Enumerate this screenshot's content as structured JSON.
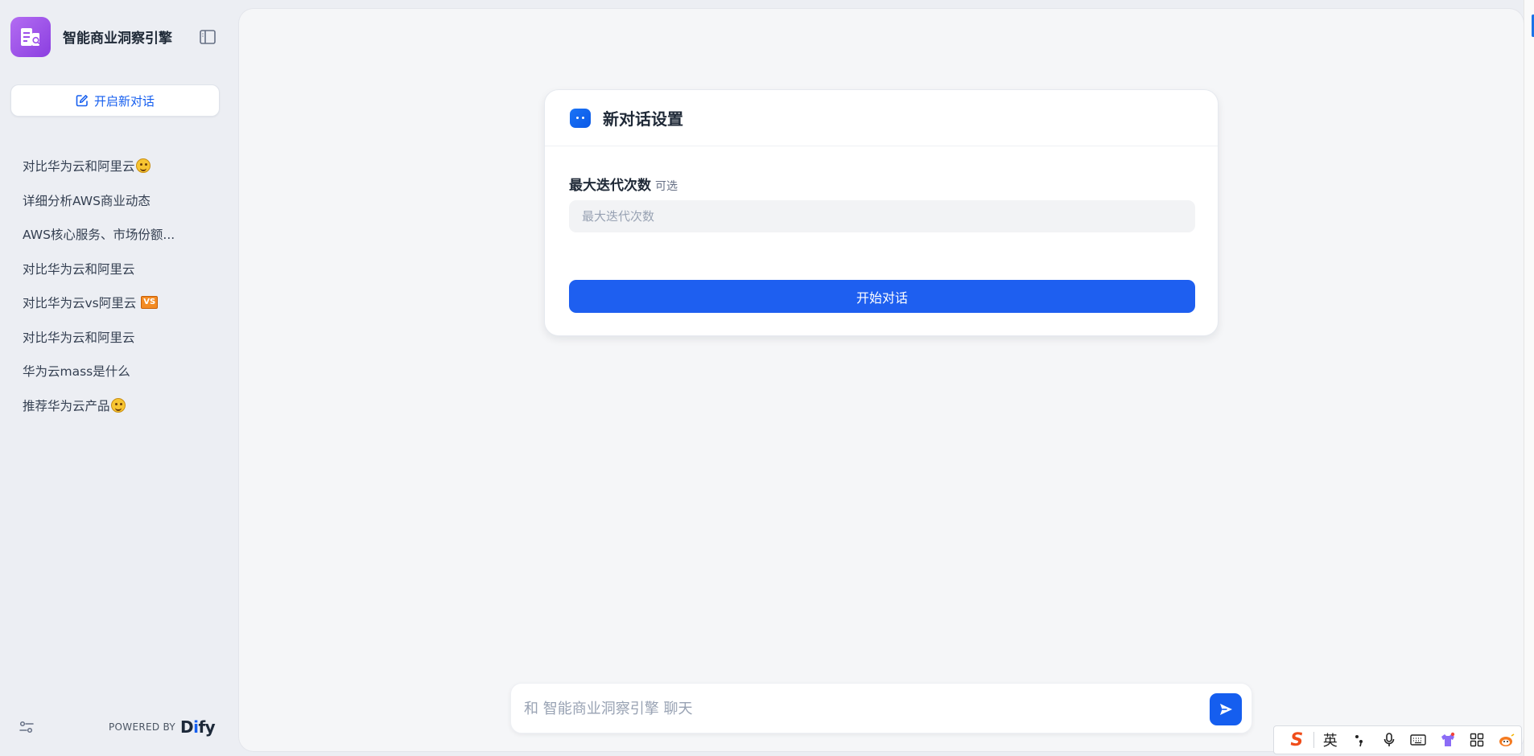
{
  "app": {
    "title": "智能商业洞察引擎",
    "brand_color": "#8b3fe0",
    "accent": "#155eef"
  },
  "sidebar": {
    "new_chat_label": "开启新对话",
    "conversations": [
      {
        "label": "对比华为云和阿里云",
        "emoji": "smile"
      },
      {
        "label": "详细分析AWS商业动态",
        "emoji": ""
      },
      {
        "label": "AWS核心服务、市场份额...",
        "emoji": ""
      },
      {
        "label": "对比华为云和阿里云",
        "emoji": ""
      },
      {
        "label": "对比华为云vs阿里云",
        "emoji": "vs"
      },
      {
        "label": "对比华为云和阿里云",
        "emoji": ""
      },
      {
        "label": "华为云mass是什么",
        "emoji": ""
      },
      {
        "label": "推荐华为云产品",
        "emoji": "smile"
      }
    ],
    "powered_by": "POWERED BY",
    "vendor": {
      "pre": "D",
      "accent": "i",
      "post": "fy"
    },
    "vs_badge": "VS"
  },
  "settings_card": {
    "title": "新对话设置",
    "field_label": "最大迭代次数",
    "field_optional": "可选",
    "field_placeholder": "最大迭代次数",
    "field_value": "",
    "start_button": "开始对话"
  },
  "chat": {
    "placeholder": "和 智能商业洞察引擎 聊天"
  },
  "ime": {
    "lang": "英",
    "logo": "S"
  }
}
